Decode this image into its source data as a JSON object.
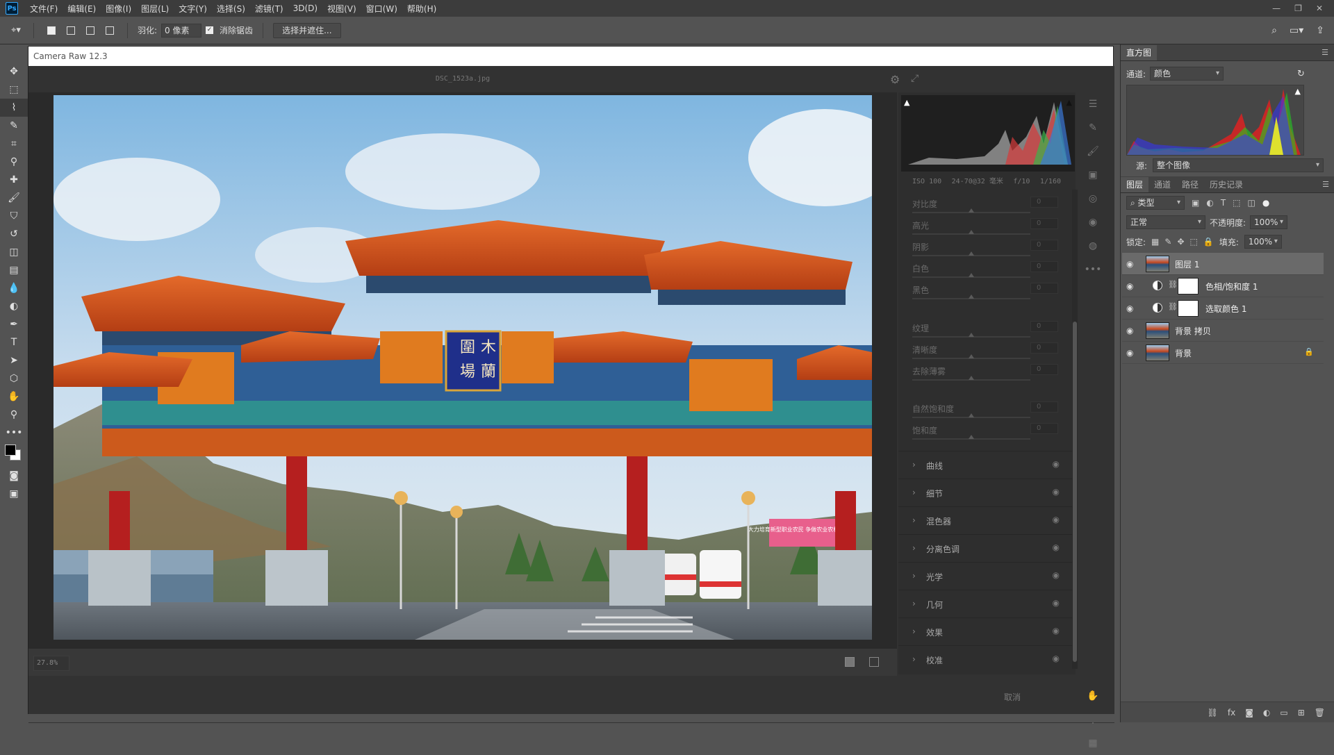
{
  "app": {
    "logo": "Ps"
  },
  "menu": [
    "文件(F)",
    "编辑(E)",
    "图像(I)",
    "图层(L)",
    "文字(Y)",
    "选择(S)",
    "滤镜(T)",
    "3D(D)",
    "视图(V)",
    "窗口(W)",
    "帮助(H)"
  ],
  "options": {
    "feather_label": "羽化:",
    "feather_value": "0 像素",
    "antialias_label": "消除锯齿",
    "select_mask_button": "选择并遮住..."
  },
  "camera_raw": {
    "title": "Camera Raw 12.3",
    "filename": "DSC_1523a.jpg",
    "zoom": "27.8%",
    "exif": {
      "iso": "ISO 100",
      "focal": "24-70@32 毫米",
      "aperture": "f/10",
      "shutter": "1/160"
    },
    "sliders_group1": [
      {
        "label": "对比度",
        "value": "0"
      },
      {
        "label": "高光",
        "value": "0"
      },
      {
        "label": "阴影",
        "value": "0"
      },
      {
        "label": "白色",
        "value": "0"
      },
      {
        "label": "黑色",
        "value": "0"
      }
    ],
    "sliders_group2": [
      {
        "label": "纹理",
        "value": "0"
      },
      {
        "label": "清晰度",
        "value": "0"
      },
      {
        "label": "去除薄雾",
        "value": "0"
      }
    ],
    "sliders_group3": [
      {
        "label": "自然饱和度",
        "value": "0"
      },
      {
        "label": "饱和度",
        "value": "0"
      }
    ],
    "sections": [
      "曲线",
      "细节",
      "混色器",
      "分离色调",
      "光学",
      "几何",
      "效果",
      "校准"
    ],
    "cancel_label": "取消",
    "sign_text": {
      "line1": "木",
      "line2": "蘭",
      "line3": "圍",
      "line4": "場"
    },
    "banner_text": "大力培育新型职业农民 争做农业农村带头人"
  },
  "histogram_panel": {
    "tab": "直方图",
    "channel_label": "通道:",
    "channel_value": "颜色",
    "source_label": "源:",
    "source_value": "整个图像"
  },
  "layers_panel": {
    "tabs": [
      "图层",
      "通道",
      "路径",
      "历史记录"
    ],
    "filter_value": "类型",
    "blend_mode": "正常",
    "opacity_label": "不透明度:",
    "opacity_value": "100%",
    "lock_label": "锁定:",
    "fill_label": "填充:",
    "fill_value": "100%",
    "layers": [
      {
        "name": "图层 1",
        "type": "pixel",
        "selected": true
      },
      {
        "name": "色相/饱和度 1",
        "type": "adjustment"
      },
      {
        "name": "选取颜色 1",
        "type": "adjustment"
      },
      {
        "name": "背景 拷贝",
        "type": "pixel"
      },
      {
        "name": "背景",
        "type": "pixel",
        "locked": true
      }
    ]
  },
  "colors": {
    "accent": "#31a8ff",
    "roof": "#d2521d",
    "pillar": "#b51f1f"
  }
}
